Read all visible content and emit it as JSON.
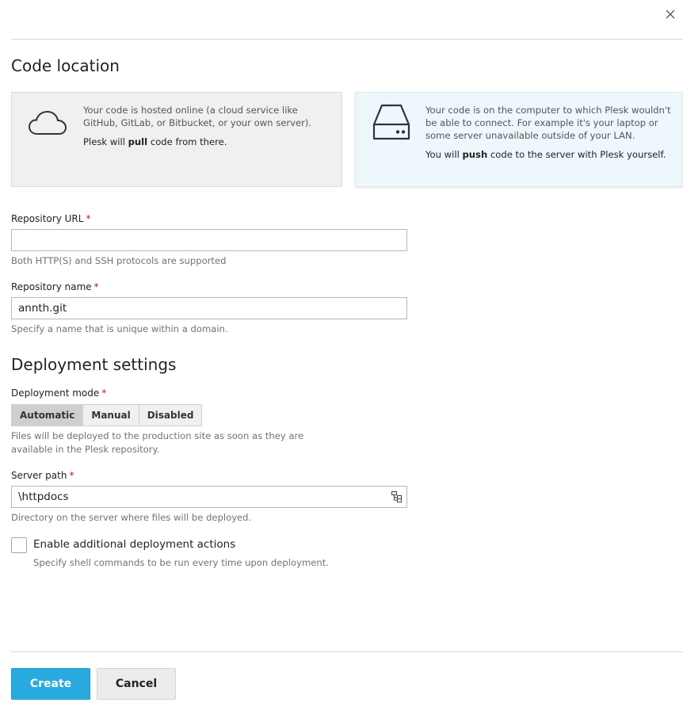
{
  "dialog": {
    "close_icon": "close-icon"
  },
  "code_location": {
    "title": "Code location",
    "cloud_card": {
      "icon": "cloud-icon",
      "line1": "Your code is hosted online (a cloud service like GitHub, GitLab, or Bitbucket, or your own server).",
      "line2_pre": "Plesk will ",
      "line2_bold": "pull",
      "line2_post": " code from there."
    },
    "local_card": {
      "icon": "hard-drive-icon",
      "line1": "Your code is on the computer to which Plesk wouldn't be able to connect. For example it's your laptop or some server unavailable outside of your LAN.",
      "line2_pre": "You will ",
      "line2_bold": "push",
      "line2_post": " code to the server with Plesk yourself."
    }
  },
  "repository_url": {
    "label": "Repository URL",
    "required_mark": "*",
    "value": "",
    "hint": "Both HTTP(S) and SSH protocols are supported"
  },
  "repository_name": {
    "label": "Repository name",
    "required_mark": "*",
    "value": "annth.git",
    "hint": "Specify a name that is unique within a domain."
  },
  "deployment": {
    "title": "Deployment settings",
    "mode_label": "Deployment mode",
    "required_mark": "*",
    "modes": [
      "Automatic",
      "Manual",
      "Disabled"
    ],
    "selected_mode": "Automatic",
    "mode_hint_line1": "Files will be deployed to the production site as soon as they are",
    "mode_hint_line2": "available in the Plesk repository."
  },
  "server_path": {
    "label": "Server path",
    "required_mark": "*",
    "value": "\\httpdocs",
    "browse_icon": "directory-tree-icon",
    "hint": "Directory on the server where files will be deployed."
  },
  "additional_actions": {
    "checked": false,
    "label": "Enable additional deployment actions",
    "hint": "Specify shell commands to be run every time upon deployment."
  },
  "footer": {
    "create_label": "Create",
    "cancel_label": "Cancel"
  },
  "colors": {
    "primary": "#28aade",
    "required": "#d2122e",
    "local_card_bg": "#eef7fc",
    "cloud_card_bg": "#f0f0f0"
  }
}
